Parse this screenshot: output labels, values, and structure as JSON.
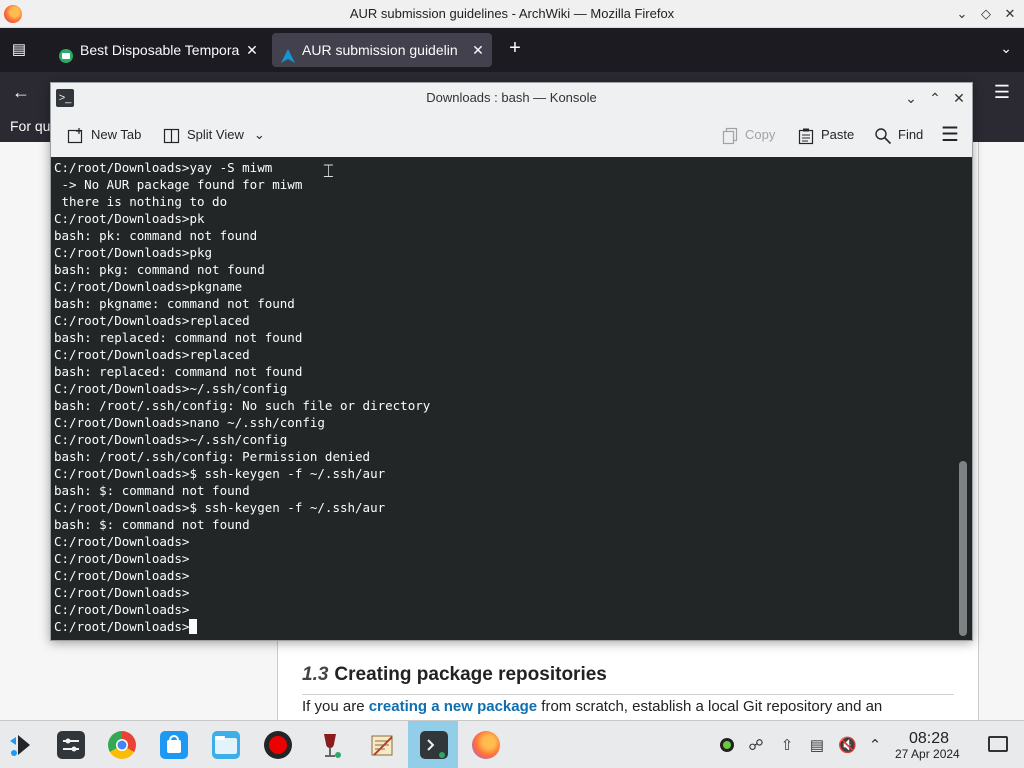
{
  "firefox": {
    "window_title": "AUR submission guidelines - ArchWiki — Mozilla Firefox",
    "tabs": [
      {
        "label": "Best Disposable Tempora",
        "active": false
      },
      {
        "label": "AUR submission guidelin",
        "active": true
      }
    ],
    "findbar_text": "For qu",
    "article": {
      "section_number": "1.3",
      "section_title": "Creating package repositories",
      "para_prefix": "If you are ",
      "para_link": "creating a new package",
      "para_suffix": " from scratch, establish a local Git repository and an"
    }
  },
  "konsole": {
    "title": "Downloads : bash — Konsole",
    "toolbar": {
      "new_tab": "New Tab",
      "split_view": "Split View",
      "copy": "Copy",
      "paste": "Paste",
      "find": "Find"
    },
    "lines": [
      "C:/root/Downloads>yay -S miwm",
      " -> No AUR package found for miwm",
      " there is nothing to do",
      "C:/root/Downloads>pk",
      "bash: pk: command not found",
      "C:/root/Downloads>pkg",
      "bash: pkg: command not found",
      "C:/root/Downloads>pkgname",
      "bash: pkgname: command not found",
      "C:/root/Downloads>replaced",
      "bash: replaced: command not found",
      "C:/root/Downloads>replaced",
      "bash: replaced: command not found",
      "C:/root/Downloads>~/.ssh/config",
      "bash: /root/.ssh/config: No such file or directory",
      "C:/root/Downloads>nano ~/.ssh/config",
      "C:/root/Downloads>~/.ssh/config",
      "bash: /root/.ssh/config: Permission denied",
      "C:/root/Downloads>$ ssh-keygen -f ~/.ssh/aur",
      "bash: $: command not found",
      "C:/root/Downloads>$ ssh-keygen -f ~/.ssh/aur",
      "bash: $: command not found",
      "C:/root/Downloads>",
      "C:/root/Downloads>",
      "C:/root/Downloads>",
      "C:/root/Downloads>",
      "C:/root/Downloads>"
    ],
    "prompt": "C:/root/Downloads>"
  },
  "taskbar": {
    "time": "08:28",
    "date": "27 Apr 2024"
  },
  "colors": {
    "terminal_bg": "#232627",
    "terminal_fg": "#fcfcfc",
    "taskbar_active": "#93cee9",
    "firefox_dark": "#1c1b22",
    "link": "#0f6fb0"
  }
}
